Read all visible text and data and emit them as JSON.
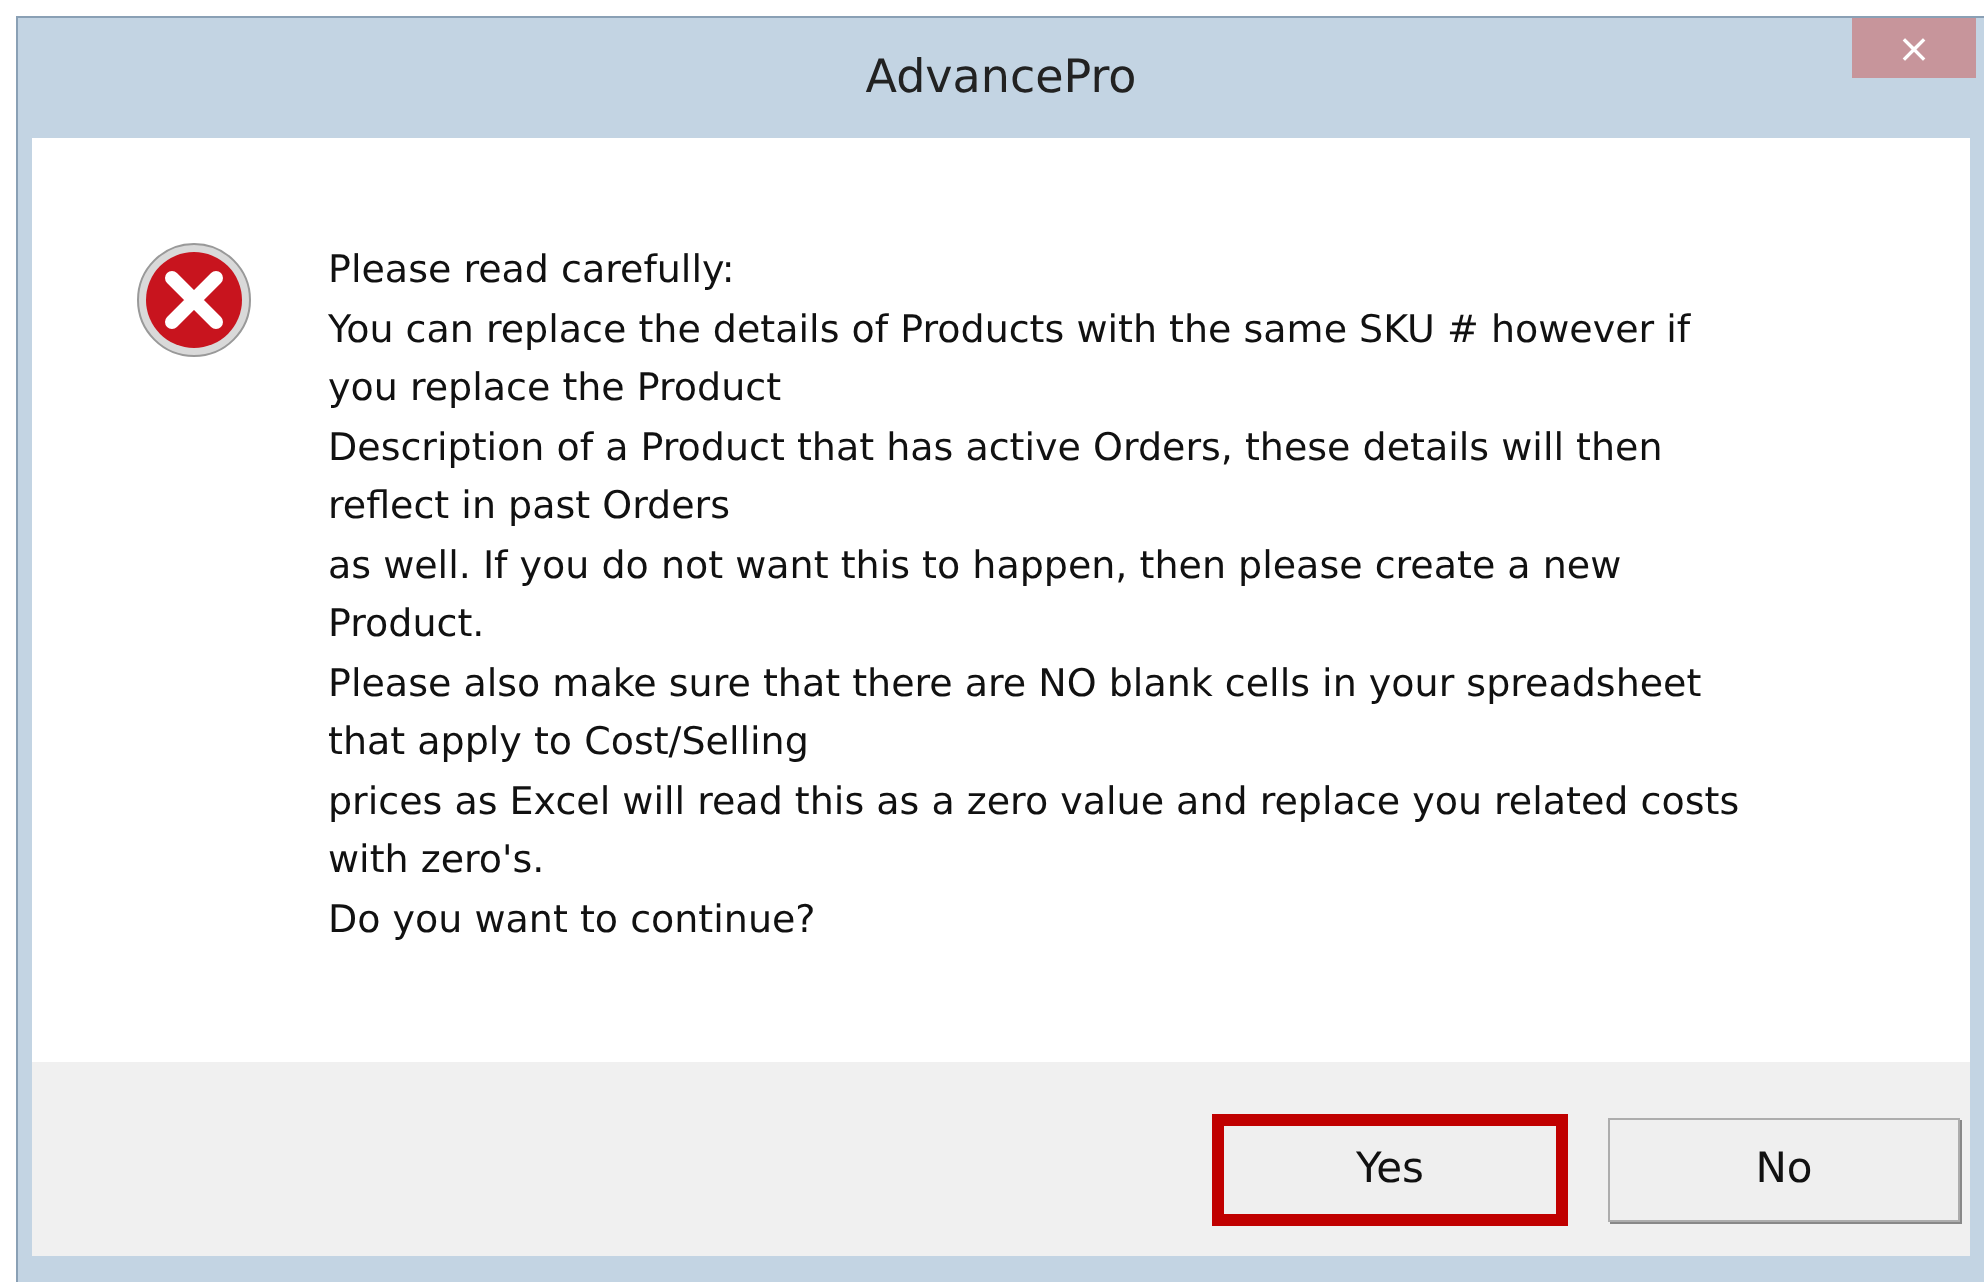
{
  "window": {
    "title": "AdvancePro",
    "close_label": "×"
  },
  "message": {
    "kind": "error",
    "lines": [
      "Please read carefully:",
      "You can replace the details of Products with the same SKU # however if",
      "you replace the Product",
      "Description of a Product that has active Orders, these details will then",
      "reflect in past Orders",
      "as well. If you do not want this to happen, then please create a new",
      "Product.",
      "Please also make sure that there are NO blank cells in your spreadsheet",
      "that apply to Cost/Selling",
      "prices as Excel will read this as a zero value and replace you related costs",
      "with zero's.",
      "Do you want to continue?"
    ]
  },
  "buttons": [
    {
      "label": "Yes",
      "highlighted": true
    },
    {
      "label": "No",
      "highlighted": false
    }
  ]
}
